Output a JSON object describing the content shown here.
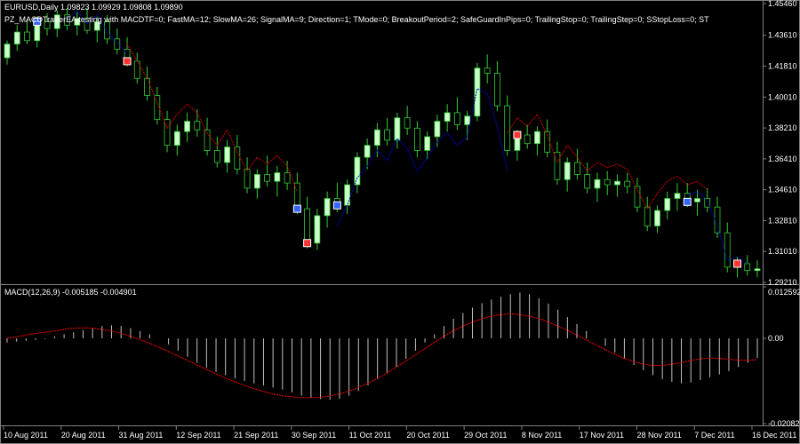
{
  "header": {
    "symbol_line": "EURUSD,Daily  1.09823 1.09929 1.09808 1.09890",
    "ea_line": "PZ_MACDTraderEA testing with MACDTF=0; FastMA=12; SlowMA=26; SignalMA=9; Direction=1; TMode=0; BreakoutPeriod=2; SafeGuardInPips=0; TrailingStop=0; TrailingStep=0; SStopLoss=0; ST"
  },
  "macd_panel": {
    "label": "MACD(12,26,9) -0.005185 -0.004901"
  },
  "colors": {
    "background": "#000000",
    "bull_candle": "#ccffcc",
    "bear_candle": "#000000",
    "wick": "#33cc33",
    "histogram": "#c0c0c0",
    "signal_line": "#ff0000",
    "trend_up_line": "#0000cc",
    "trend_down_line": "#cc0000",
    "text": "#ffffff",
    "grid": "#808080"
  },
  "chart_data": [
    {
      "type": "candlestick",
      "title": "EURUSD,Daily",
      "ylim": [
        1.2921,
        1.4546
      ],
      "y_ticks": [
        "1.45460",
        "1.43610",
        "1.41810",
        "1.40010",
        "1.38210",
        "1.36410",
        "1.34610",
        "1.32810",
        "1.31010",
        "1.29210"
      ],
      "x_ticks": [
        "10 Aug 2011",
        "20 Aug 2011",
        "31 Aug 2011",
        "12 Sep 2011",
        "21 Sep 2011",
        "30 Sep 2011",
        "11 Oct 2011",
        "20 Oct 2011",
        "29 Oct 2011",
        "8 Nov 2011",
        "17 Nov 2011",
        "28 Nov 2011",
        "7 Dec 2011",
        "16 Dec 2011"
      ],
      "series": [
        {
          "values_ohlc": [
            [
              1.423,
              1.433,
              1.419,
              1.431
            ],
            [
              1.431,
              1.442,
              1.427,
              1.438
            ],
            [
              1.438,
              1.445,
              1.431,
              1.433
            ],
            [
              1.433,
              1.447,
              1.429,
              1.444
            ],
            [
              1.444,
              1.449,
              1.436,
              1.44
            ],
            [
              1.44,
              1.451,
              1.435,
              1.448
            ],
            [
              1.448,
              1.452,
              1.439,
              1.442
            ],
            [
              1.442,
              1.45,
              1.436,
              1.446
            ],
            [
              1.446,
              1.452,
              1.437,
              1.439
            ],
            [
              1.439,
              1.447,
              1.432,
              1.444
            ],
            [
              1.444,
              1.448,
              1.431,
              1.434
            ],
            [
              1.434,
              1.44,
              1.425,
              1.428
            ],
            [
              1.428,
              1.435,
              1.418,
              1.421
            ],
            [
              1.421,
              1.426,
              1.408,
              1.411
            ],
            [
              1.411,
              1.418,
              1.398,
              1.401
            ],
            [
              1.401,
              1.406,
              1.384,
              1.387
            ],
            [
              1.387,
              1.392,
              1.368,
              1.372
            ],
            [
              1.372,
              1.384,
              1.366,
              1.38
            ],
            [
              1.38,
              1.391,
              1.374,
              1.386
            ],
            [
              1.386,
              1.393,
              1.377,
              1.381
            ],
            [
              1.381,
              1.388,
              1.366,
              1.369
            ],
            [
              1.369,
              1.377,
              1.359,
              1.362
            ],
            [
              1.362,
              1.375,
              1.356,
              1.371
            ],
            [
              1.371,
              1.378,
              1.355,
              1.358
            ],
            [
              1.358,
              1.365,
              1.344,
              1.347
            ],
            [
              1.347,
              1.358,
              1.341,
              1.355
            ],
            [
              1.355,
              1.366,
              1.348,
              1.351
            ],
            [
              1.351,
              1.36,
              1.342,
              1.356
            ],
            [
              1.356,
              1.363,
              1.346,
              1.35
            ],
            [
              1.35,
              1.356,
              1.332,
              1.335
            ],
            [
              1.335,
              1.342,
              1.312,
              1.315
            ],
            [
              1.315,
              1.335,
              1.311,
              1.331
            ],
            [
              1.331,
              1.345,
              1.324,
              1.341
            ],
            [
              1.341,
              1.35,
              1.333,
              1.337
            ],
            [
              1.337,
              1.352,
              1.332,
              1.349
            ],
            [
              1.349,
              1.368,
              1.344,
              1.365
            ],
            [
              1.365,
              1.376,
              1.358,
              1.372
            ],
            [
              1.372,
              1.385,
              1.365,
              1.381
            ],
            [
              1.381,
              1.388,
              1.372,
              1.375
            ],
            [
              1.375,
              1.391,
              1.37,
              1.388
            ],
            [
              1.388,
              1.395,
              1.378,
              1.382
            ],
            [
              1.382,
              1.386,
              1.365,
              1.369
            ],
            [
              1.369,
              1.38,
              1.364,
              1.377
            ],
            [
              1.377,
              1.39,
              1.371,
              1.386
            ],
            [
              1.386,
              1.396,
              1.38,
              1.391
            ],
            [
              1.391,
              1.4,
              1.381,
              1.384
            ],
            [
              1.384,
              1.392,
              1.375,
              1.389
            ],
            [
              1.389,
              1.42,
              1.386,
              1.417
            ],
            [
              1.417,
              1.425,
              1.408,
              1.414
            ],
            [
              1.414,
              1.421,
              1.392,
              1.395
            ],
            [
              1.395,
              1.401,
              1.366,
              1.369
            ],
            [
              1.369,
              1.381,
              1.363,
              1.378
            ],
            [
              1.378,
              1.384,
              1.37,
              1.373
            ],
            [
              1.373,
              1.383,
              1.366,
              1.38
            ],
            [
              1.38,
              1.387,
              1.365,
              1.368
            ],
            [
              1.368,
              1.374,
              1.349,
              1.352
            ],
            [
              1.352,
              1.365,
              1.345,
              1.362
            ],
            [
              1.362,
              1.37,
              1.352,
              1.355
            ],
            [
              1.355,
              1.362,
              1.344,
              1.347
            ],
            [
              1.347,
              1.356,
              1.339,
              1.352
            ],
            [
              1.352,
              1.357,
              1.343,
              1.349
            ],
            [
              1.349,
              1.355,
              1.342,
              1.351
            ],
            [
              1.351,
              1.356,
              1.344,
              1.348
            ],
            [
              1.348,
              1.353,
              1.333,
              1.336
            ],
            [
              1.336,
              1.342,
              1.322,
              1.325
            ],
            [
              1.325,
              1.337,
              1.321,
              1.334
            ],
            [
              1.334,
              1.345,
              1.329,
              1.341
            ],
            [
              1.341,
              1.35,
              1.334,
              1.344
            ],
            [
              1.344,
              1.35,
              1.336,
              1.339
            ],
            [
              1.339,
              1.346,
              1.331,
              1.341
            ],
            [
              1.341,
              1.347,
              1.333,
              1.336
            ],
            [
              1.336,
              1.342,
              1.318,
              1.321
            ],
            [
              1.321,
              1.327,
              1.298,
              1.301
            ],
            [
              1.301,
              1.307,
              1.295,
              1.303
            ],
            [
              1.303,
              1.308,
              1.296,
              1.299
            ],
            [
              1.299,
              1.305,
              1.295,
              1.3
            ]
          ]
        }
      ]
    },
    {
      "type": "bar",
      "title": "MACD(12,26,9)",
      "ylim": [
        -0.020823,
        0.012592
      ],
      "y_ticks": [
        "0.012592",
        "0.00",
        "-0.020823"
      ],
      "series": [
        {
          "name": "MACD",
          "values": [
            -0.001,
            -0.0008,
            -0.0006,
            -0.0004,
            -0.0002,
            0.0005,
            0.001,
            0.0015,
            0.002,
            0.0025,
            0.003,
            0.0032,
            0.003,
            0.0025,
            0.0018,
            0.001,
            0.0,
            -0.0015,
            -0.003,
            -0.0045,
            -0.006,
            -0.0072,
            -0.0082,
            -0.009,
            -0.0098,
            -0.0104,
            -0.011,
            -0.0115,
            -0.012,
            -0.0125,
            -0.0132,
            -0.014,
            -0.0145,
            -0.0148,
            -0.015,
            -0.0148,
            -0.014,
            -0.0128,
            -0.0115,
            -0.01,
            -0.0085,
            -0.007,
            -0.005,
            -0.003,
            -0.001,
            0.001,
            0.003,
            0.0048,
            0.0062,
            0.0075,
            0.0086,
            0.0095,
            0.0102,
            0.0108,
            0.0112,
            0.0108,
            0.0098,
            0.0085,
            0.007,
            0.0052,
            0.0035,
            0.0018,
            0.0,
            -0.0018,
            -0.0035,
            -0.005,
            -0.0065,
            -0.0078,
            -0.009,
            -0.01,
            -0.0106,
            -0.011,
            -0.0108,
            -0.0102,
            -0.0095,
            -0.0088,
            -0.008,
            -0.007,
            -0.006,
            -0.0048
          ]
        },
        {
          "name": "Signal",
          "values": [
            0.0,
            0.0004,
            0.0008,
            0.0012,
            0.0015,
            0.0018,
            0.0022,
            0.0025,
            0.0026,
            0.0025,
            0.0022,
            0.0018,
            0.0012,
            0.0005,
            -0.0003,
            -0.0012,
            -0.0022,
            -0.0032,
            -0.0043,
            -0.0054,
            -0.0065,
            -0.0076,
            -0.0087,
            -0.0097,
            -0.0106,
            -0.0115,
            -0.0123,
            -0.013,
            -0.0136,
            -0.014,
            -0.0143,
            -0.0145,
            -0.0145,
            -0.0144,
            -0.0141,
            -0.0136,
            -0.0129,
            -0.012,
            -0.011,
            -0.0098,
            -0.0085,
            -0.007,
            -0.0055,
            -0.004,
            -0.0025,
            -0.001,
            0.0005,
            0.0018,
            0.003,
            0.004,
            0.0048,
            0.0054,
            0.0058,
            0.006,
            0.0058,
            0.0054,
            0.0048,
            0.004,
            0.003,
            0.002,
            0.0008,
            -0.0004,
            -0.0016,
            -0.0028,
            -0.0039,
            -0.0049,
            -0.0057,
            -0.0063,
            -0.0066,
            -0.0066,
            -0.0063,
            -0.0059,
            -0.0054,
            -0.005,
            -0.0048,
            -0.0049,
            -0.0051,
            -0.0053,
            -0.0054,
            -0.0052
          ]
        }
      ]
    }
  ]
}
